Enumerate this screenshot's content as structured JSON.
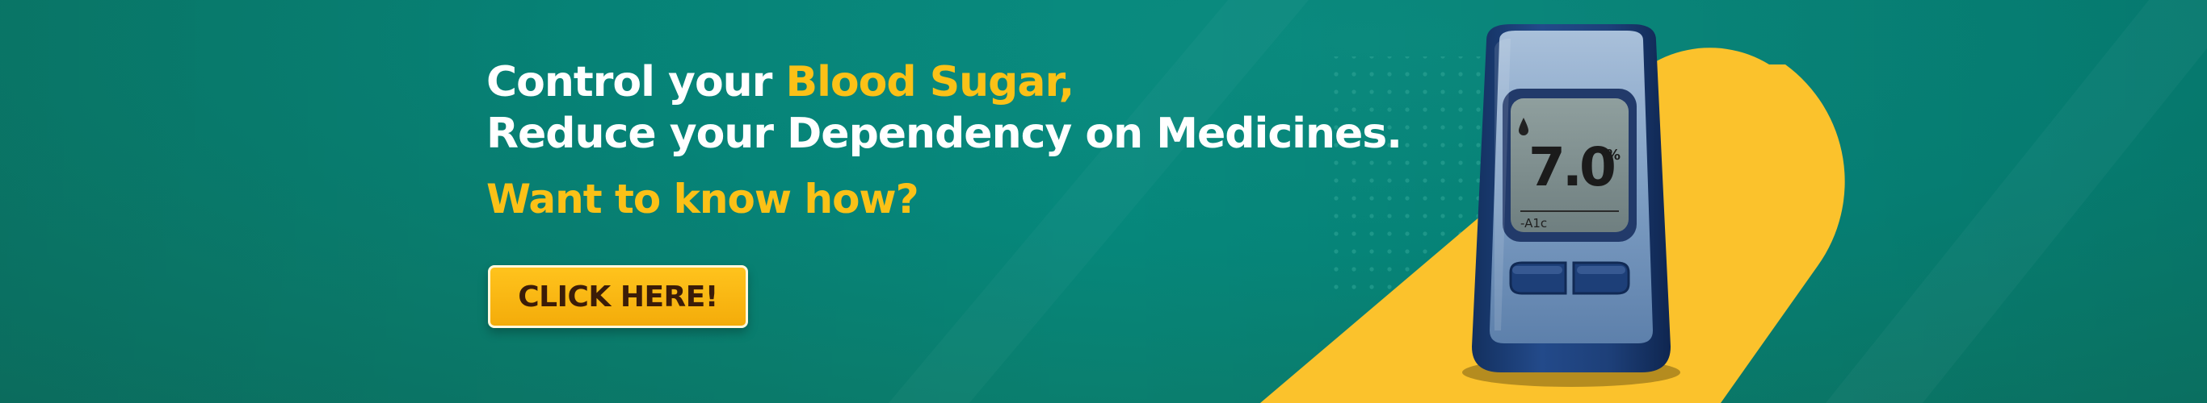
{
  "banner": {
    "headline": {
      "prefix": "Control your ",
      "highlight": "Blood Sugar,",
      "line2": "Reduce your Dependency on Medicines."
    },
    "subhead": "Want to know how?",
    "cta_label": "CLICK HERE!"
  },
  "device": {
    "reading_value": "7.0",
    "reading_unit": "%",
    "reading_label": "-A1c",
    "icons": [
      "blood-drop-icon"
    ]
  },
  "colors": {
    "background": "#06877b",
    "accent": "#fbc117",
    "text": "#ffffff",
    "cta_text": "#3b1c08",
    "device_body": "#1d3f78"
  }
}
